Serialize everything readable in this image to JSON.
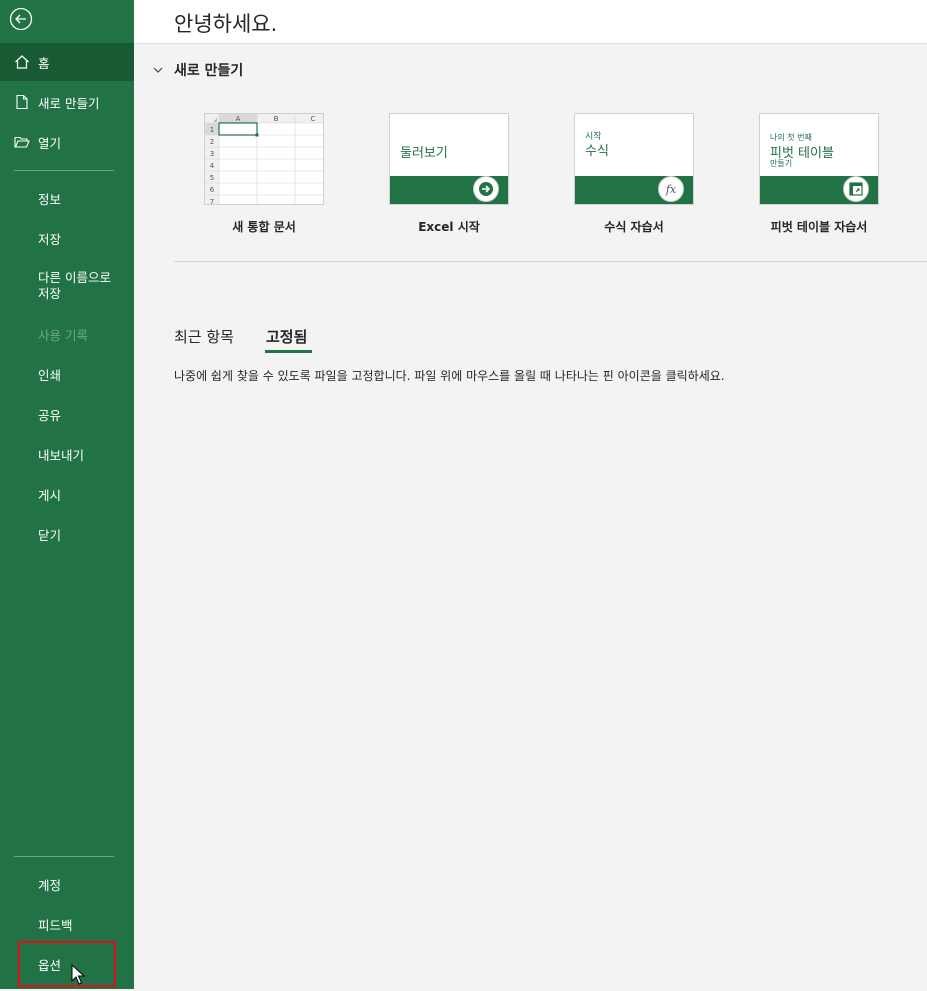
{
  "header": {
    "greeting": "안녕하세요."
  },
  "sidebar": {
    "items_top": [
      {
        "label": "홈",
        "icon": "home-icon",
        "selected": true
      },
      {
        "label": "새로 만들기",
        "icon": "new-file-icon"
      },
      {
        "label": "열기",
        "icon": "open-folder-icon"
      }
    ],
    "items_mid": [
      {
        "label": "정보"
      },
      {
        "label": "저장"
      },
      {
        "label_l1": "다른 이름으로",
        "label_l2": "저장"
      },
      {
        "label": "사용 기록",
        "disabled": true
      },
      {
        "label": "인쇄"
      },
      {
        "label": "공유"
      },
      {
        "label": "내보내기"
      },
      {
        "label": "게시"
      },
      {
        "label": "닫기"
      }
    ],
    "items_bottom": [
      {
        "label": "계정"
      },
      {
        "label": "피드백"
      },
      {
        "label": "옵션"
      }
    ]
  },
  "new_section": {
    "title": "새로 만들기",
    "templates": [
      {
        "label": "새 통합 문서"
      },
      {
        "label": "Excel 시작",
        "thumb_text": "둘러보기"
      },
      {
        "label": "수식 자습서",
        "thumb_small": "시작",
        "thumb_big": "수식"
      },
      {
        "label": "피벗 테이블 자습서",
        "thumb_small": "나의 첫 번째",
        "thumb_big": "피벗 테이블",
        "thumb_small2": "만들기"
      }
    ],
    "sheet": {
      "cols": [
        "A",
        "B",
        "C"
      ],
      "rows": [
        "1",
        "2",
        "3",
        "4",
        "5",
        "6",
        "7"
      ]
    }
  },
  "recent": {
    "tabs": [
      "최근 항목",
      "고정됨"
    ],
    "active_tab": "고정됨",
    "pinned_message": "나중에 쉽게 찾을 수 있도록 파일을 고정합니다. 파일 위에 마우스를 올릴 때 나타나는 핀 아이콘을 클릭하세요."
  },
  "colors": {
    "sidebar": "#217346",
    "selected": "#185a34",
    "highlight": "#e0101b"
  }
}
